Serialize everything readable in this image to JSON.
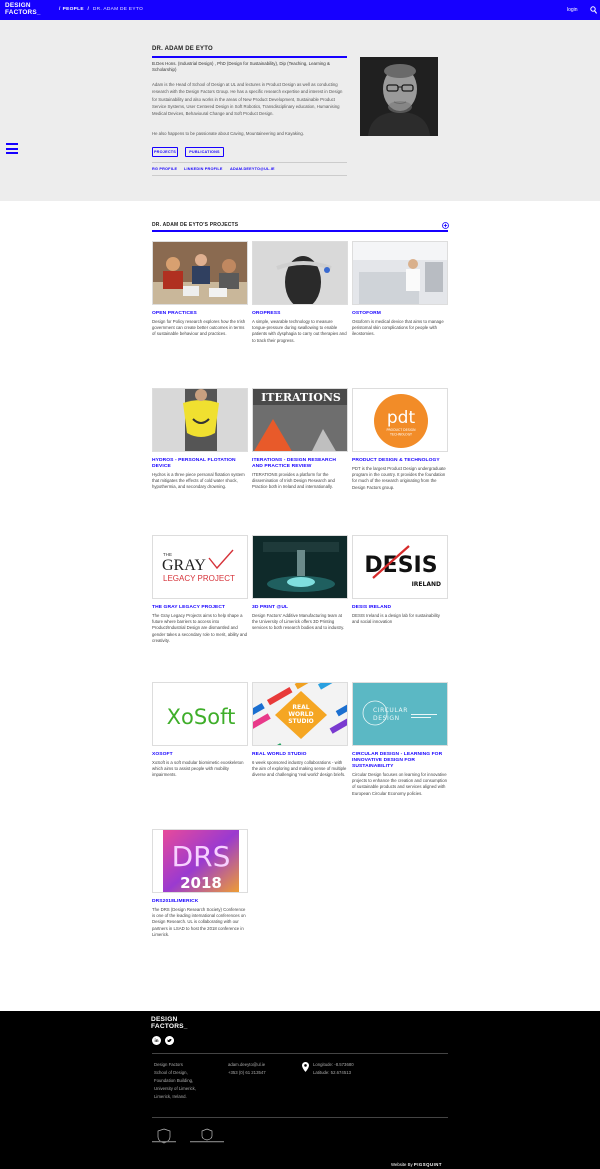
{
  "header": {
    "logo_line1": "DESIGN",
    "logo_line2": "FACTORS_",
    "breadcrumb_section": "PEOPLE",
    "breadcrumb_current": "DR. ADAM DE EYTO",
    "login_label": "login"
  },
  "profile": {
    "name": "DR. ADAM DE EYTO",
    "qualifications": "B.Des Hons. (Industrial Design) , PhD (Design for Sustainability), Dip (Teaching, Learning & Scholarship)",
    "bio": "Adam is the Head of School of Design at UL and lectures in Product Design as well as conducting research with the Design Factors Group. He has a specific research expertise and interest in Design for Sustainability and also works in the areas of New Product Development, Sustainable Product Service Systems, User Centered Design in Soft Robotics, Transdisciplinary education, Humanising Medical Devices, Behavioural Change and Soft Product Design.",
    "bio_extra": "He also happens to be passionate about Caving, Mountaineering and Kayaking.",
    "buttons": [
      "PROJECTS",
      "PUBLICATIONS"
    ],
    "links": [
      "RG PROFILE",
      "LINKEDIN PROFILE",
      "ADAM.DEEYTO@UL.IE"
    ]
  },
  "projects": {
    "title": "DR. ADAM DE EYTO'S PROJECTS",
    "items": [
      {
        "title": "OPEN PRACTICES",
        "desc": "Design for Policy research explores how the Irish government can create better outcomes in terms of sustainable behaviour and practices."
      },
      {
        "title": "OROPRESS",
        "desc": "A simple, wearable technology to measure tongue-pressure during swallowing to enable patients with dysphagia to carry out therapies and to track their progress."
      },
      {
        "title": "OSTOFORM",
        "desc": "Ostoform is medical device that aims to manage peristomal skin complications for people with ileostomies."
      },
      {
        "title": "HYDROS - PERSONAL FLOTATION DEVICE",
        "desc": "Hydros is a three piece personal flotation system that mitigates the effects of cold water shock, hypothermia, and secondary drowning."
      },
      {
        "title": "ITERATIONS - DESIGN RESEARCH AND PRACTICE REVIEW",
        "desc": "ITERATIONS provides a platform for the dissemination of Irish Design Research and Practice both in Ireland and internationally."
      },
      {
        "title": "PRODUCT DESIGN & TECHNOLOGY",
        "desc": "PDT is the largest Product Design undergraduate program in the country. It provides the foundation for much of the research originating from the Design Factors group."
      },
      {
        "title": "THE GRAY LEGACY PROJECT",
        "desc": "The Gray Legacy Projects aims to help shape a future where barriers to access into Product/Industrial Design are dismantled and gender takes a secondary role to merit, ability and creativity."
      },
      {
        "title": "3D PRINT @UL",
        "desc": "Design Factors' Additive Manufacturing team at the University of Limerick offers 3D Printing services to both research bodies and to industry."
      },
      {
        "title": "DESIS IRELAND",
        "desc": "DESIS Ireland is a design lab for sustainability and social innovation"
      },
      {
        "title": "XOSOFT",
        "desc": "XoSoft is a soft modular biomimetic exoskeleton which aims to assist people with mobility impairments."
      },
      {
        "title": "REAL WORLD STUDIO",
        "desc": "6 week sponsored industry collaborations - with the aim of exploring and making sense of multiple diverse and challenging 'real world' design briefs."
      },
      {
        "title": "CIRCULAR DESIGN - LEARNING FOR INNOVATIVE DESIGN FOR SUSTAINABILITY",
        "desc": "Circular Design focuses on learning for innovative projects to enhance the creation and consumption of sustainable products and services aligned with European Circular Economy policies."
      },
      {
        "title": "DRS2018LIMERICK",
        "desc": "The DRS (Design Research Society) Conference is one of the leading international conferences on Design Research. UL is collaborating with our partners in LSAD to host the 2018 conference in Limerick."
      }
    ],
    "thumb_text": {
      "iterations": "ITERATIONS",
      "pdt_logo": "pdt",
      "pdt_sub1": "PRODUCT DESIGN",
      "pdt_sub2": "TECHNOLOGY",
      "gray_the": "THE",
      "gray_main": "GRAY",
      "gray_sub": "LEGACY PROJECT",
      "desis": "DESIS",
      "desis_sub": "IRELAND",
      "xosoft": "XoSoft",
      "rws1": "REAL",
      "rws2": "WORLD",
      "rws3": "STUDIO",
      "circular1": "CIRCULAR",
      "circular2": "DESIGN",
      "drs": "DRS",
      "drs_year": "2018"
    }
  },
  "footer": {
    "logo_line1": "DESIGN",
    "logo_line2": "FACTORS_",
    "address": [
      "Design Factors",
      "School of Design,",
      "Foundation Building,",
      "University of Limerick,",
      "Limerick, Ireland."
    ],
    "contact": [
      "adam.deeyto@ul.ie",
      "+353 (0) 61 213547"
    ],
    "coords": [
      "Longitude: -8.573680",
      "Latitude: 52.674513"
    ],
    "credit_prefix": "Website By",
    "credit_name": "PIGSQUINT",
    "brand_color": "#1600ff",
    "icons": [
      "linkedin-icon",
      "twitter-icon",
      "map-pin-icon"
    ]
  }
}
